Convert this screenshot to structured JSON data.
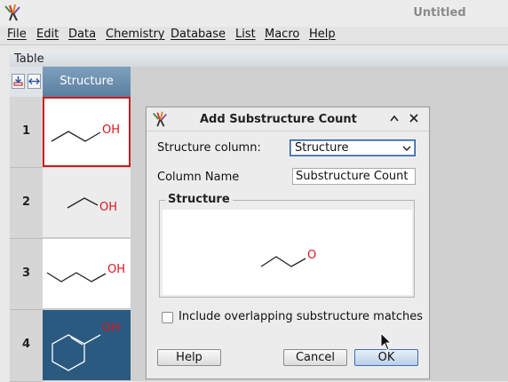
{
  "window": {
    "title": "Untitled",
    "app_icon": "app-logo-icon"
  },
  "menu": [
    {
      "label": "File"
    },
    {
      "label": "Edit"
    },
    {
      "label": "Data"
    },
    {
      "label": "Chemistry"
    },
    {
      "label": "Database"
    },
    {
      "label": "List"
    },
    {
      "label": "Macro"
    },
    {
      "label": "Help"
    }
  ],
  "table": {
    "panel_title": "Table",
    "column_header": "Structure",
    "corner_icons": [
      "download-icon",
      "resize-columns-icon"
    ],
    "rows": [
      {
        "number": "1",
        "label": "OH"
      },
      {
        "number": "2",
        "label": "OH"
      },
      {
        "number": "3",
        "label": "OH"
      },
      {
        "number": "4",
        "label": "OH"
      }
    ]
  },
  "dialog": {
    "title": "Add Substructure Count",
    "structure_column_label": "Structure column:",
    "structure_column_value": "Structure",
    "column_name_label": "Column Name",
    "column_name_value": "Substructure Count",
    "structure_group_label": "Structure",
    "substructure_atom": "O",
    "checkbox_label": "Include overlapping substructure matches",
    "checkbox_checked": false,
    "help_button": "Help",
    "cancel_button": "Cancel",
    "ok_button": "OK"
  },
  "colors": {
    "accent": "#3d6fb0",
    "header_blue": "#6a8aab",
    "heteroatom": "#e0141e",
    "selection_red": "#d0191b",
    "row4_background": "#2b5a80"
  }
}
